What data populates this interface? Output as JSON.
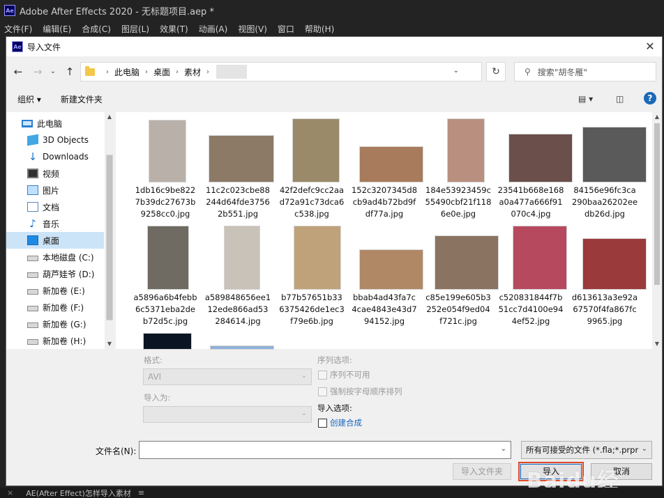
{
  "app": {
    "title": "Adobe After Effects 2020 - 无标题项目.aep *",
    "logo": "Ae",
    "menu": [
      "文件(F)",
      "编辑(E)",
      "合成(C)",
      "图层(L)",
      "效果(T)",
      "动画(A)",
      "视图(V)",
      "窗口",
      "帮助(H)"
    ],
    "bottom_close": "×",
    "bottom_tab": "AE(After Effect)怎样导入素材",
    "bottom_menu": "≡"
  },
  "dialog": {
    "title": "导入文件",
    "close": "✕",
    "breadcrumbs": [
      "此电脑",
      "桌面",
      "素材"
    ],
    "search_placeholder": "搜索\"胡冬雁\"",
    "toolbar": {
      "organize": "组织 ▾",
      "new_folder": "新建文件夹"
    },
    "nav": [
      {
        "label": "此电脑",
        "icon": "computer-icon"
      },
      {
        "label": "3D Objects",
        "icon": "3d-objects-icon"
      },
      {
        "label": "Downloads",
        "icon": "downloads-icon"
      },
      {
        "label": "视频",
        "icon": "video-icon"
      },
      {
        "label": "图片",
        "icon": "pictures-icon"
      },
      {
        "label": "文档",
        "icon": "documents-icon"
      },
      {
        "label": "音乐",
        "icon": "music-icon"
      },
      {
        "label": "桌面",
        "icon": "desktop-icon",
        "selected": true
      },
      {
        "label": "本地磁盘 (C:)",
        "icon": "local-disk-icon"
      },
      {
        "label": "葫芦娃爷 (D:)",
        "icon": "drive-icon"
      },
      {
        "label": "新加卷 (E:)",
        "icon": "drive-icon"
      },
      {
        "label": "新加卷 (F:)",
        "icon": "drive-icon"
      },
      {
        "label": "新加卷 (G:)",
        "icon": "drive-icon"
      },
      {
        "label": "新加卷 (H:)",
        "icon": "drive-icon"
      }
    ],
    "files": [
      {
        "lines": [
          "1db16c9be822",
          "7b39dc27673b",
          "9258cc0.jpg"
        ],
        "color": "#b9b0aa"
      },
      {
        "lines": [
          "11c2c023cbe88",
          "244d64fde3756",
          "2b551.jpg"
        ],
        "color": "#8c7a66"
      },
      {
        "lines": [
          "42f2defc9cc2aa",
          "d72a91c73dca6",
          "c538.jpg"
        ],
        "color": "#9a8a6a"
      },
      {
        "lines": [
          "152c3207345d8",
          "cb9ad4b72bd9f",
          "df77a.jpg"
        ],
        "color": "#a77b5b"
      },
      {
        "lines": [
          "184e53923459c",
          "55490cbf21f118",
          "6e0e.jpg"
        ],
        "color": "#b98f7f"
      },
      {
        "lines": [
          "23541b668e168",
          "a0a477a666f91",
          "070c4.jpg"
        ],
        "color": "#6b4f4a"
      },
      {
        "lines": [
          "84156e96fc3ca",
          "290baa26202ee",
          "db26d.jpg"
        ],
        "color": "#5a5a5a"
      },
      {
        "lines": [
          "a5896a6b4febb",
          "6c5371eba2de",
          "b72d5c.jpg"
        ],
        "color": "#6f6a62"
      },
      {
        "lines": [
          "a589848656ee1",
          "12ede866ad53",
          "284614.jpg"
        ],
        "color": "#c9c2b8"
      },
      {
        "lines": [
          "b77b57651b33",
          "6375426de1ec3",
          "f79e6b.jpg"
        ],
        "color": "#c0a27a"
      },
      {
        "lines": [
          "bbab4ad43fa7c",
          "4cae4843e43d7",
          "94152.jpg"
        ],
        "color": "#b08866"
      },
      {
        "lines": [
          "c85e199e605b3",
          "252e054f9ed04",
          "f721c.jpg"
        ],
        "color": "#8a7360"
      },
      {
        "lines": [
          "c520831844f7b",
          "51cc7d4100e94",
          "4ef52.jpg"
        ],
        "color": "#b7495e"
      },
      {
        "lines": [
          "d613613a3e92a",
          "67570f4fa867fc",
          "9965.jpg"
        ],
        "color": "#9b3a3a"
      }
    ],
    "options": {
      "format_label": "格式:",
      "format_value": "AVI",
      "import_as_label": "导入为:",
      "sequence_label": "序列选项:",
      "seq_unavailable": "序列不可用",
      "force_alpha": "强制按字母顺序排列",
      "import_options_label": "导入选项:",
      "create_comp": "创建合成"
    },
    "filename_label": "文件名(N):",
    "filename_value": "",
    "filetype": "所有可接受的文件 (*.fla;*.prpr",
    "buttons": {
      "import_folder": "导入文件夹",
      "import": "导入",
      "cancel": "取消"
    }
  },
  "watermark": "Baidu经验",
  "colors": {
    "ae_bg": "#232323",
    "accent_blue": "#1565c0",
    "highlight_red": "#e04a28",
    "nav_selected": "#cce4f7"
  }
}
